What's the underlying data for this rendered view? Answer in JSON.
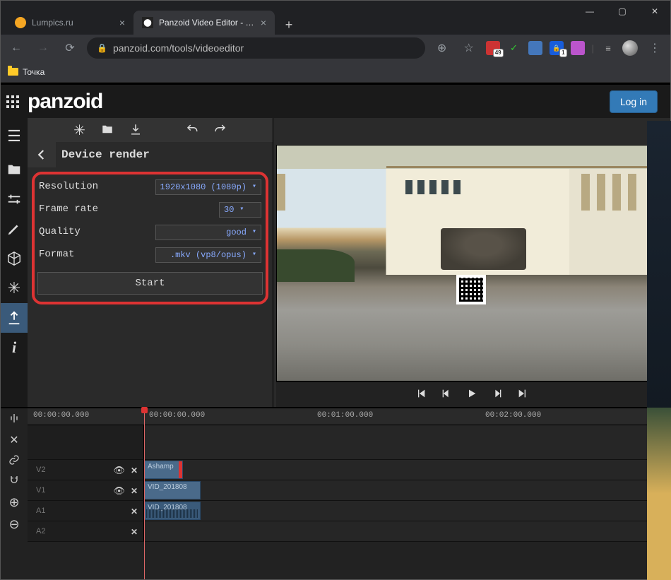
{
  "window": {
    "min": "—",
    "max": "▢",
    "close": "✕"
  },
  "tabs": [
    {
      "title": "Lumpics.ru",
      "active": false,
      "fav_color": "#f5a623"
    },
    {
      "title": "Panzoid Video Editor - Edit Vide",
      "active": true,
      "fav": "P"
    }
  ],
  "address": {
    "url": "panzoid.com/tools/videoeditor",
    "bookmark_folder": "Точка"
  },
  "ext_badges": {
    "rt": "49",
    "one": "1"
  },
  "app": {
    "brand": "panzoid",
    "login": "Log in"
  },
  "panel": {
    "title": "Device render",
    "rows": {
      "resolution_label": "Resolution",
      "resolution_value": "1920x1080 (1080p)",
      "framerate_label": "Frame rate",
      "framerate_value": "30",
      "quality_label": "Quality",
      "quality_value": "good",
      "format_label": "Format",
      "format_value": ".mkv (vp8/opus)"
    },
    "start": "Start"
  },
  "timeline": {
    "ruler": [
      "00:00:00.000",
      "00:00:00.000",
      "00:01:00.000",
      "00:02:00.000"
    ],
    "tracks": [
      {
        "name": "V2",
        "eye": true,
        "x": true,
        "clip": "Ashamp"
      },
      {
        "name": "V1",
        "eye": true,
        "x": true,
        "clip": "VID_201808"
      },
      {
        "name": "A1",
        "eye": false,
        "x": true,
        "clip": "VID_201808"
      },
      {
        "name": "A2",
        "eye": false,
        "x": true,
        "clip": ""
      }
    ]
  }
}
